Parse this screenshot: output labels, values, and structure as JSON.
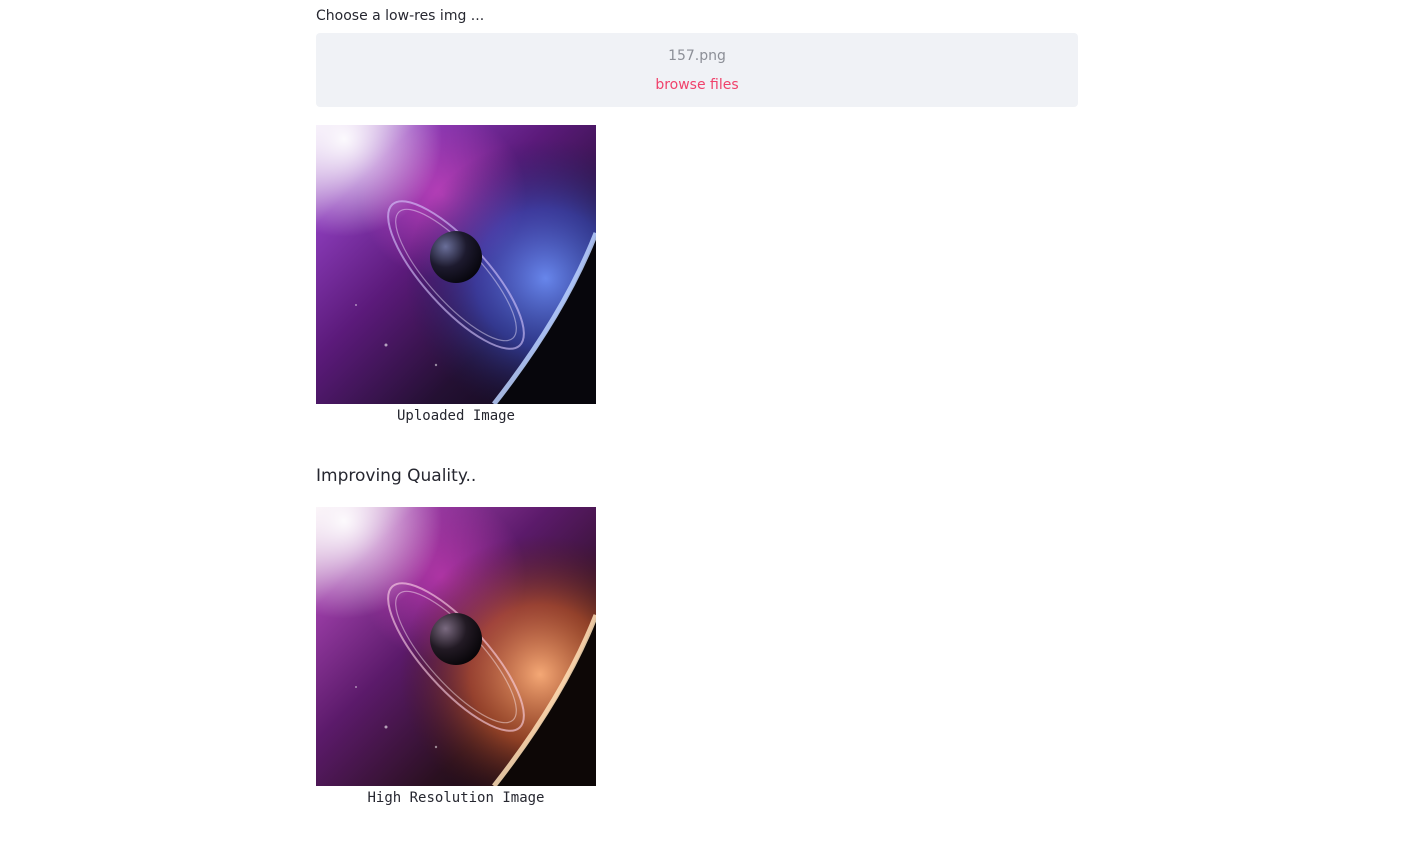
{
  "uploader": {
    "label": "Choose a low-res img ...",
    "file_name": "157.png",
    "browse_label": "browse files"
  },
  "images": {
    "uploaded_caption": "Uploaded Image",
    "status": "Improving Quality..",
    "high_res_caption": "High Resolution Image"
  },
  "colors": {
    "accent": "#f0426b",
    "dropzone_bg": "#f0f2f6",
    "text": "#262730",
    "muted_text": "#8c8f97"
  }
}
